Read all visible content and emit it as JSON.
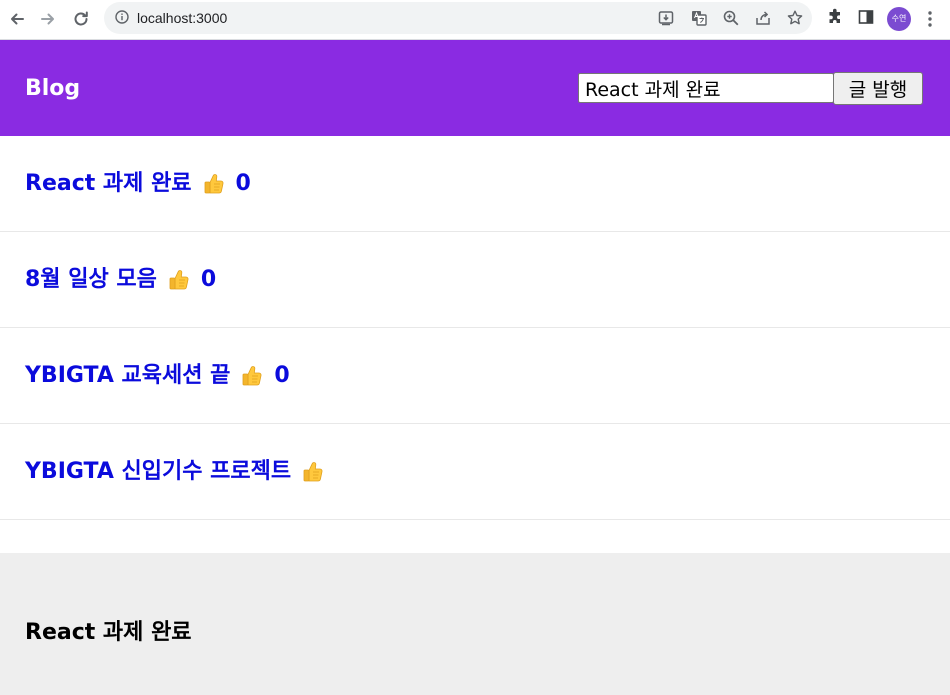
{
  "browser": {
    "url": "localhost:3000",
    "profile_initials": "수연"
  },
  "header": {
    "logo": "Blog",
    "input_value": "React 과제 완료",
    "post_button_label": "글 발행"
  },
  "posts": [
    {
      "title": "React 과제 완료",
      "likes": "0"
    },
    {
      "title": "8월 일상 모음",
      "likes": "0"
    },
    {
      "title": "YBIGTA 교육세션 끝",
      "likes": "0"
    },
    {
      "title": "YBIGTA 신입기수 프로젝트",
      "likes": ""
    }
  ],
  "detail": {
    "title": "React 과제 완료"
  },
  "colors": {
    "header_bg": "#8a2be2",
    "title_color": "#0b0bdc",
    "detail_bg": "#eeeeee"
  },
  "icons": {
    "like": "thumbs-up-icon"
  }
}
